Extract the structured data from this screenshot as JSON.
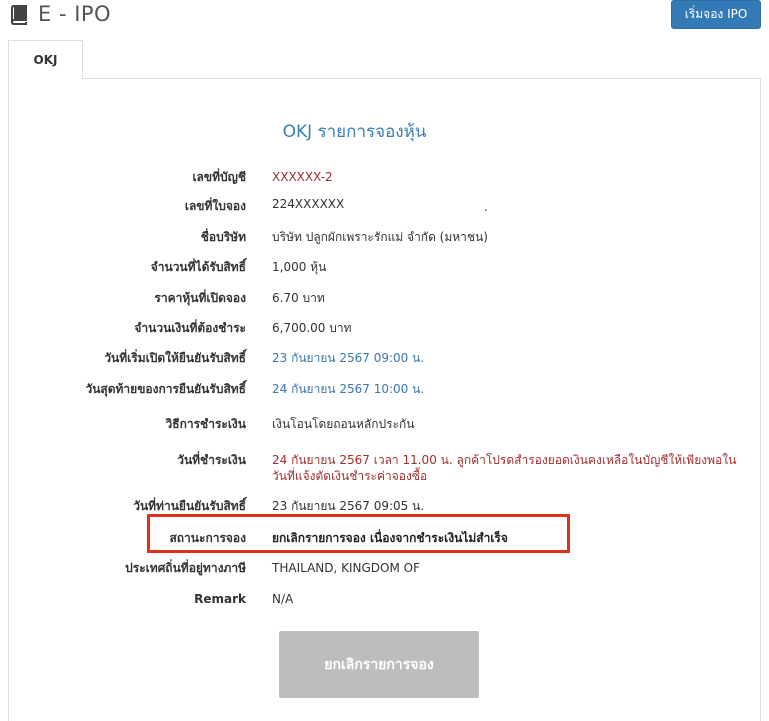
{
  "header": {
    "app_title": "E - IPO",
    "start_button": "เริ่มจอง IPO"
  },
  "tabs": [
    {
      "label": "OKJ"
    }
  ],
  "main": {
    "heading": "OKJ รายการจองหุ้น",
    "fields": [
      {
        "label": "เลขที่บัญชี",
        "value": "XXXXXX-2"
      },
      {
        "label": "เลขที่ใบจอง",
        "value": "224XXXXXX"
      },
      {
        "label": "ชื่อบริษัท",
        "value": "บริษัท ปลูกผักเพราะรักแม่ จำกัด (มหาชน)"
      },
      {
        "label": "จำนวนที่ได้รับสิทธิ์",
        "value": "1,000 หุ้น"
      },
      {
        "label": "ราคาหุ้นที่เปิดจอง",
        "value": "6.70 บาท"
      },
      {
        "label": "จำนวนเงินที่ต้องชำระ",
        "value": "6,700.00 บาท"
      },
      {
        "label": "วันที่เริ่มเปิดให้ยืนยันรับสิทธิ์",
        "value": "23 กันยายน 2567 09:00 น."
      },
      {
        "label": "วันสุดท้ายของการยืนยันรับสิทธิ์",
        "value": "24 กันยายน 2567 10:00 น."
      },
      {
        "label": "วิธีการชำระเงิน",
        "value": "เงินโอนโดยถอนหลักประกัน"
      },
      {
        "label": "วันที่ชำระเงิน",
        "value": "24 กันยายน 2567 เวลา 11.00 น. ลูกค้าโปรดสำรองยอดเงินคงเหลือในบัญชีให้เพียงพอในวันที่แจ้งตัดเงินชำระค่าจองซื้อ"
      },
      {
        "label": "วันที่ท่านยืนยันรับสิทธิ์",
        "value": "23 กันยายน 2567 09:05 น."
      },
      {
        "label": "สถานะการจอง",
        "value": "ยกเลิกรายการจอง เนื่องจากชำระเงินไม่สำเร็จ"
      },
      {
        "label": "ประเทศถิ่นที่อยู่ทางภาษี",
        "value": "THAILAND, KINGDOM OF"
      },
      {
        "label": "Remark",
        "value": "N/A"
      }
    ],
    "cancel_button": "ยกเลิกรายการจอง"
  },
  "colors": {
    "heading": "#3a80b8",
    "primary_button": "#337ab7",
    "red_value": "#a03030",
    "blue_value": "#3a78b0",
    "highlight_border": "#e0301e",
    "disabled_button": "#bdbdbd"
  }
}
